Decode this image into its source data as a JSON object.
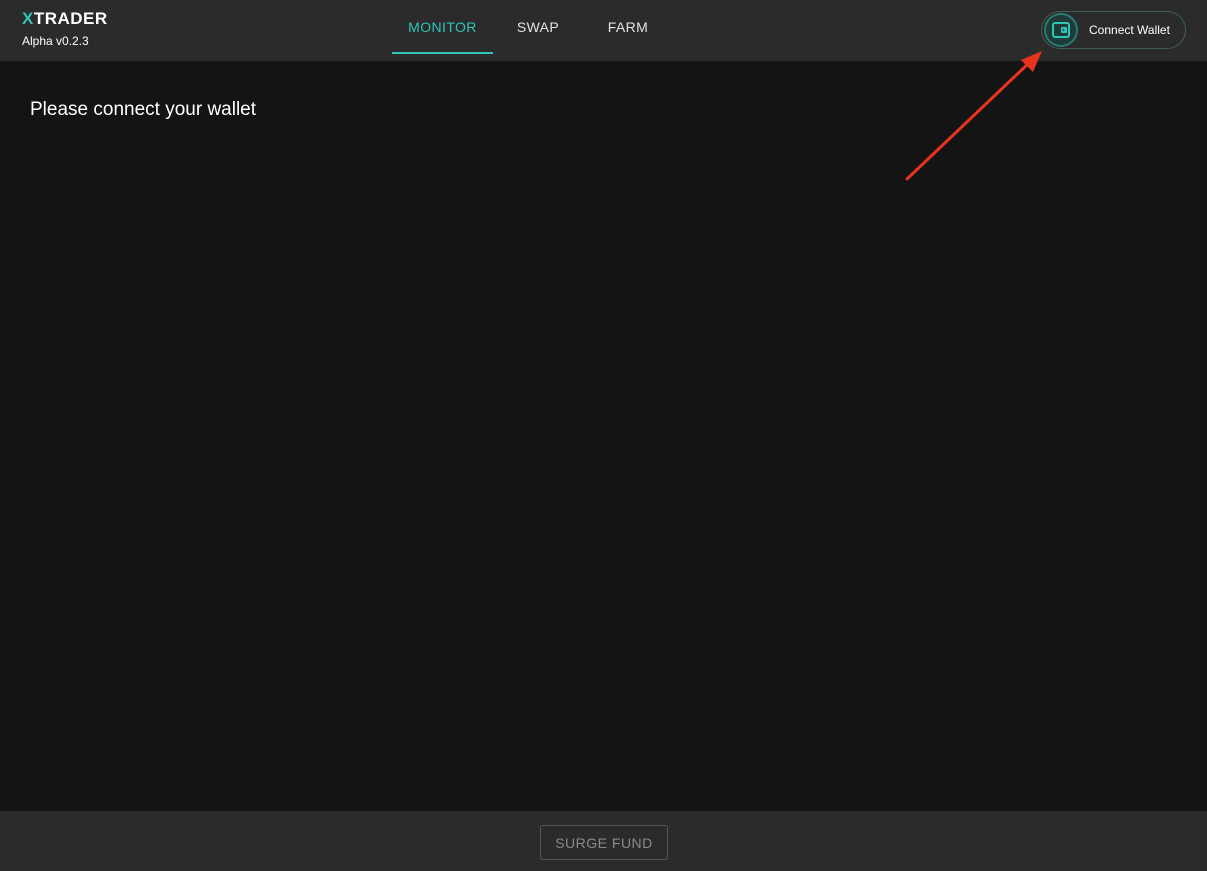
{
  "header": {
    "logo_prefix": "X",
    "logo_rest": "TRADER",
    "version": "Alpha v0.2.3",
    "tabs": [
      {
        "label": "MONITOR",
        "active": true
      },
      {
        "label": "SWAP",
        "active": false
      },
      {
        "label": "FARM",
        "active": false
      }
    ],
    "connect_wallet": {
      "label": "Connect Wallet",
      "icon": "wallet-icon"
    }
  },
  "main": {
    "message": "Please connect your wallet"
  },
  "annotation": {
    "type": "arrow",
    "color": "#e8331f",
    "points_to": "connect-wallet-button"
  },
  "footer": {
    "surge_fund_label": "SURGE FUND"
  },
  "colors": {
    "accent": "#2ec4b6",
    "header_bg": "#2b2b2b",
    "page_bg": "#141414"
  }
}
